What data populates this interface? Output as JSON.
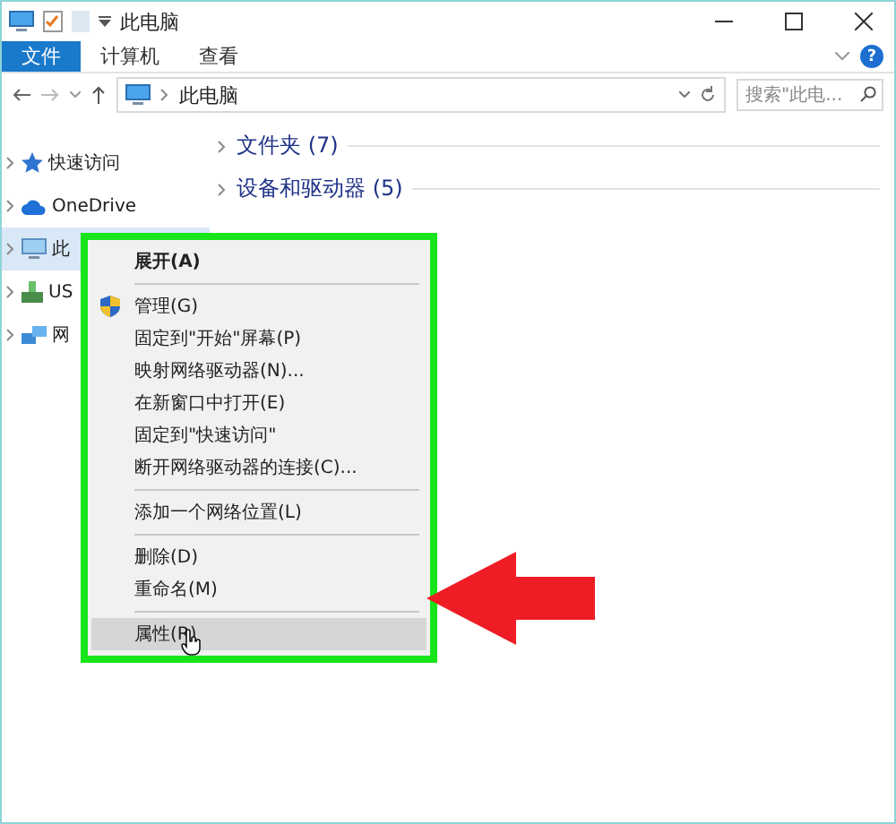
{
  "window": {
    "title": "此电脑"
  },
  "ribbon": {
    "tabs": [
      {
        "label": "文件",
        "selected": true
      },
      {
        "label": "计算机",
        "selected": false
      },
      {
        "label": "查看",
        "selected": false
      }
    ],
    "help": "?"
  },
  "address": {
    "path": "此电脑",
    "search_placeholder": "搜索\"此电..."
  },
  "sidebar": {
    "items": [
      {
        "label": "快速访问",
        "selected": false
      },
      {
        "label": "OneDrive",
        "selected": false
      },
      {
        "label": "此",
        "selected": true
      },
      {
        "label": "US",
        "selected": false
      },
      {
        "label": "网",
        "selected": false
      }
    ]
  },
  "content": {
    "groups": [
      {
        "label": "文件夹 (7)"
      },
      {
        "label": "设备和驱动器 (5)"
      }
    ]
  },
  "context_menu": {
    "items": [
      {
        "kind": "default",
        "label": "展开(A)",
        "selected": false
      },
      {
        "kind": "separator"
      },
      {
        "kind": "admin",
        "label": "管理(G)",
        "selected": false
      },
      {
        "kind": "command",
        "label": "固定到\"开始\"屏幕(P)",
        "selected": false
      },
      {
        "kind": "command",
        "label": "映射网络驱动器(N)...",
        "selected": false
      },
      {
        "kind": "command",
        "label": "在新窗口中打开(E)",
        "selected": false
      },
      {
        "kind": "command",
        "label": "固定到\"快速访问\"",
        "selected": false
      },
      {
        "kind": "command",
        "label": "断开网络驱动器的连接(C)...",
        "selected": false
      },
      {
        "kind": "separator"
      },
      {
        "kind": "command",
        "label": "添加一个网络位置(L)",
        "selected": false
      },
      {
        "kind": "separator"
      },
      {
        "kind": "command",
        "label": "删除(D)",
        "selected": false
      },
      {
        "kind": "command",
        "label": "重命名(M)",
        "selected": false
      },
      {
        "kind": "separator"
      },
      {
        "kind": "command",
        "label": "属性(R)",
        "selected": true
      }
    ]
  }
}
